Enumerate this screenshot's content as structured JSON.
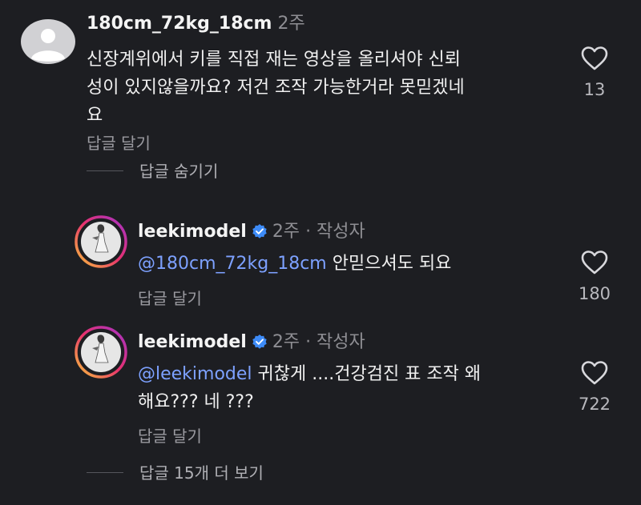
{
  "comments": [
    {
      "username": "180cm_72kg_18cm",
      "time": "2주",
      "text": [
        "신장계위에서 키를 직접 재는 영상을 올리셔야 신뢰",
        "성이 있지않을까요? 저건 조작 가능한거라 못믿겠네",
        "요"
      ],
      "reply_label": "답글 달기",
      "likes": "13"
    },
    {
      "username": "leekimodel",
      "time": "2주",
      "author_tag": "· 작성자",
      "mention": "@180cm_72kg_18cm",
      "text": [
        "안믿으셔도 되요"
      ],
      "reply_label": "답글 달기",
      "likes": "180"
    },
    {
      "username": "leekimodel",
      "time": "2주",
      "author_tag": "· 작성자",
      "mention": "@leekimodel",
      "text": [
        "귀찮게 ....건강검진 표 조작 왜",
        "해요??? 네 ???"
      ],
      "reply_label": "답글 달기",
      "likes": "722"
    }
  ],
  "hide_replies_label": "답글 숨기기",
  "more_replies_label": "답글 15개 더 보기",
  "colors": {
    "background": "#1d1e22",
    "mention": "#7da1ff",
    "verified": "#3d8bf7",
    "story_ring": [
      "#f9c33c",
      "#e8316d",
      "#a332c9"
    ]
  },
  "icons": [
    "default-avatar-icon",
    "heart-outline-icon",
    "verified-badge-icon"
  ]
}
